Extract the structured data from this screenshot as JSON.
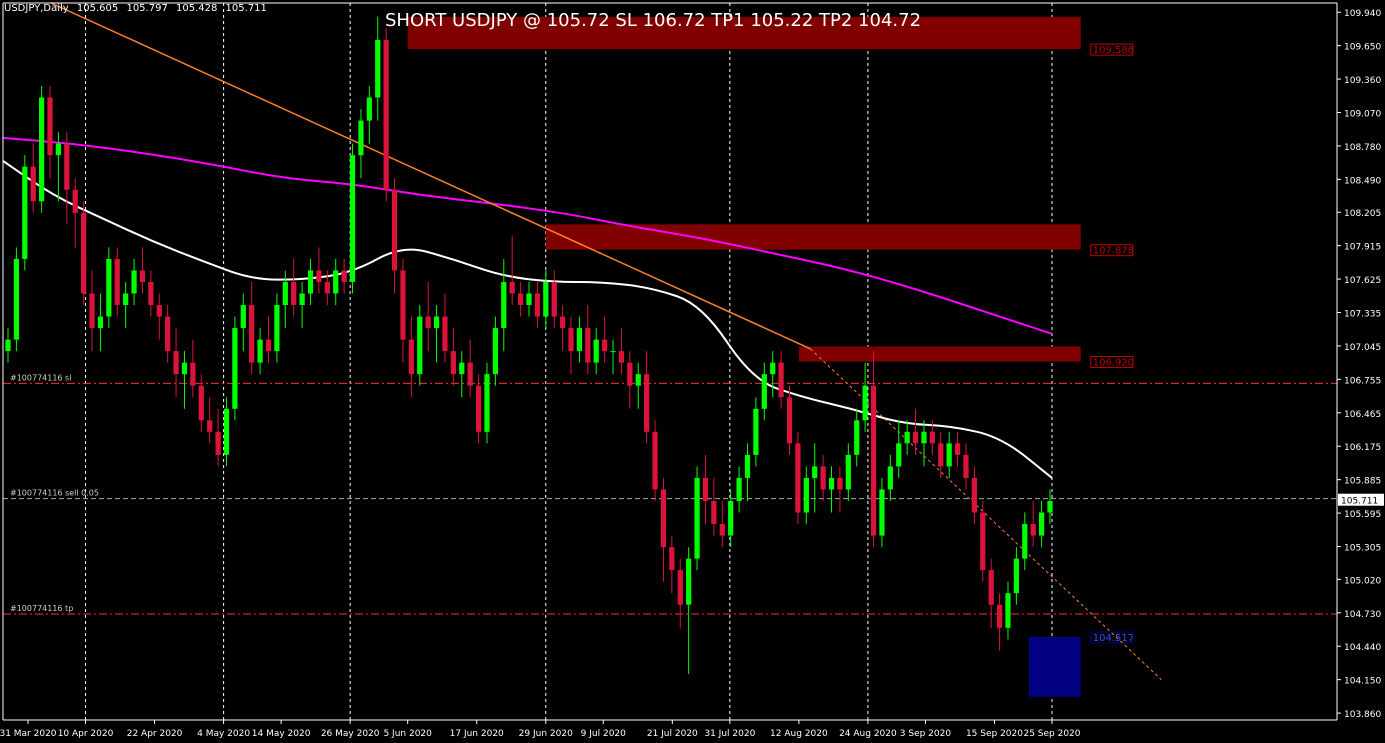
{
  "window": {
    "symbol_tf": "USDJPY,Daily",
    "ohlc": [
      "105.605",
      "105.797",
      "105.428",
      "105.711"
    ]
  },
  "title": "SHORT USDJPY @ 105.72 SL 106.72 TP1 105.22 TP2 104.72",
  "colors": {
    "background": "#000000",
    "bull": "#00ff00",
    "bear": "#dc143c",
    "ma_fast": "#ffffff",
    "ma_slow": "#ff00ff",
    "trendline": "#ff7f27",
    "zone": "#800000",
    "demand_zone": "#000080",
    "order_line": "#ff3030",
    "entry_line": "#8fbc8f"
  },
  "chart_data": {
    "type": "candlestick",
    "ylim": [
      103.8,
      110.02
    ],
    "y_ticks": [
      "109.940",
      "109.650",
      "109.360",
      "109.070",
      "108.780",
      "108.490",
      "108.205",
      "107.915",
      "107.625",
      "107.335",
      "107.045",
      "106.755",
      "106.465",
      "106.175",
      "105.885",
      "105.595",
      "105.305",
      "105.020",
      "104.730",
      "104.440",
      "104.150",
      "103.860"
    ],
    "x_ticks": [
      "31 Mar 2020",
      "10 Apr 2020",
      "22 Apr 2020",
      "4 May 2020",
      "14 May 2020",
      "26 May 2020",
      "5 Jun 2020",
      "17 Jun 2020",
      "29 Jun 2020",
      "9 Jul 2020",
      "21 Jul 2020",
      "31 Jul 2020",
      "12 Aug 2020",
      "24 Aug 2020",
      "3 Sep 2020",
      "15 Sep 2020",
      "25 Sep 2020"
    ],
    "grid_dates": [
      "10 Apr 2020",
      "4 May 2020",
      "26 May 2020",
      "29 Jun 2020",
      "31 Jul 2020",
      "24 Aug 2020",
      "25 Sep 2020"
    ],
    "current_price": "105.711",
    "zones": [
      {
        "label": "109.586",
        "high": 109.9,
        "low": 109.62,
        "start": "5 Jun 2020",
        "end": "30 Sep 2020"
      },
      {
        "label": "107.878",
        "high": 108.1,
        "low": 107.88,
        "start": "29 Jun 2020",
        "end": "30 Sep 2020"
      },
      {
        "label": "106.920",
        "high": 107.04,
        "low": 106.91,
        "start": "12 Aug 2020",
        "end": "30 Sep 2020"
      }
    ],
    "demand_zone": {
      "label": "104.517",
      "high": 104.52,
      "low": 104.0,
      "start": "21 Sep 2020",
      "end": "30 Sep 2020"
    },
    "order_lines": [
      {
        "label": "#100774116 sl",
        "price": 106.72,
        "style": "dashdot"
      },
      {
        "label": "#100774116 sell 0.05",
        "price": 105.72,
        "style": "dash"
      },
      {
        "label": "#100774116 tp",
        "price": 104.72,
        "style": "dashdot"
      }
    ],
    "trendline": {
      "start": {
        "date": "4 Apr 2020",
        "price": 110.02
      },
      "end": {
        "date": "14 Aug 2020",
        "price": 107.02
      },
      "extend_to": {
        "date": "14 Oct 2020",
        "price": 104.15
      }
    },
    "ma_fast": [
      108.65,
      108.35,
      108.15,
      107.95,
      107.78,
      107.62,
      107.62,
      107.68,
      107.92,
      107.8,
      107.65,
      107.6,
      107.6,
      107.55,
      107.4,
      106.75,
      106.6,
      106.5,
      106.37,
      106.35,
      106.25,
      105.9
    ],
    "ma_slow": [
      108.85,
      108.8,
      108.72,
      108.62,
      108.5,
      108.45,
      108.35,
      108.28,
      108.2,
      108.08,
      107.98,
      107.85,
      107.72,
      107.55,
      107.35,
      107.15
    ],
    "candles": [
      [
        107.0,
        107.2,
        106.9,
        107.1
      ],
      [
        107.1,
        107.9,
        107.0,
        107.8
      ],
      [
        107.8,
        108.7,
        107.7,
        108.6
      ],
      [
        108.6,
        108.8,
        108.2,
        108.3
      ],
      [
        108.3,
        109.3,
        108.2,
        109.2
      ],
      [
        109.2,
        109.3,
        108.5,
        108.7
      ],
      [
        108.7,
        108.9,
        108.3,
        108.8
      ],
      [
        108.8,
        108.9,
        108.1,
        108.4
      ],
      [
        108.4,
        108.5,
        107.9,
        108.2
      ],
      [
        108.2,
        108.3,
        107.4,
        107.5
      ],
      [
        107.5,
        107.7,
        107.0,
        107.2
      ],
      [
        107.2,
        107.5,
        107.0,
        107.3
      ],
      [
        107.3,
        107.9,
        107.2,
        107.8
      ],
      [
        107.8,
        107.9,
        107.3,
        107.4
      ],
      [
        107.4,
        107.6,
        107.2,
        107.5
      ],
      [
        107.5,
        107.8,
        107.4,
        107.7
      ],
      [
        107.7,
        107.9,
        107.5,
        107.6
      ],
      [
        107.6,
        107.7,
        107.3,
        107.4
      ],
      [
        107.4,
        107.5,
        107.1,
        107.3
      ],
      [
        107.3,
        107.4,
        106.9,
        107.0
      ],
      [
        107.0,
        107.2,
        106.6,
        106.8
      ],
      [
        106.8,
        107.0,
        106.5,
        106.9
      ],
      [
        106.9,
        107.1,
        106.6,
        106.7
      ],
      [
        106.7,
        106.8,
        106.3,
        106.4
      ],
      [
        106.4,
        106.6,
        106.2,
        106.3
      ],
      [
        106.3,
        106.5,
        106.0,
        106.1
      ],
      [
        106.1,
        106.6,
        106.0,
        106.5
      ],
      [
        106.5,
        107.3,
        106.4,
        107.2
      ],
      [
        107.2,
        107.5,
        107.0,
        107.4
      ],
      [
        107.4,
        107.6,
        106.8,
        106.9
      ],
      [
        106.9,
        107.2,
        106.8,
        107.1
      ],
      [
        107.1,
        107.3,
        106.9,
        107.0
      ],
      [
        107.0,
        107.5,
        106.9,
        107.4
      ],
      [
        107.4,
        107.7,
        107.2,
        107.6
      ],
      [
        107.6,
        107.8,
        107.3,
        107.4
      ],
      [
        107.4,
        107.6,
        107.2,
        107.5
      ],
      [
        107.5,
        107.8,
        107.4,
        107.7
      ],
      [
        107.7,
        107.9,
        107.5,
        107.6
      ],
      [
        107.6,
        107.7,
        107.4,
        107.5
      ],
      [
        107.5,
        107.8,
        107.4,
        107.7
      ],
      [
        107.7,
        107.8,
        107.5,
        107.6
      ],
      [
        107.6,
        108.8,
        107.5,
        108.7
      ],
      [
        108.7,
        109.1,
        108.5,
        109.0
      ],
      [
        109.0,
        109.3,
        108.8,
        109.2
      ],
      [
        109.2,
        109.9,
        109.0,
        109.7
      ],
      [
        109.7,
        109.8,
        108.3,
        108.4
      ],
      [
        108.4,
        108.5,
        107.5,
        107.7
      ],
      [
        107.7,
        107.8,
        106.9,
        107.1
      ],
      [
        107.1,
        107.3,
        106.6,
        106.8
      ],
      [
        106.8,
        107.4,
        106.7,
        107.3
      ],
      [
        107.3,
        107.6,
        107.0,
        107.2
      ],
      [
        107.2,
        107.4,
        106.9,
        107.3
      ],
      [
        107.3,
        107.5,
        106.9,
        107.0
      ],
      [
        107.0,
        107.2,
        106.7,
        106.8
      ],
      [
        106.8,
        107.0,
        106.6,
        106.9
      ],
      [
        106.9,
        107.1,
        106.6,
        106.7
      ],
      [
        106.7,
        106.8,
        106.2,
        106.3
      ],
      [
        106.3,
        106.9,
        106.2,
        106.8
      ],
      [
        106.8,
        107.3,
        106.7,
        107.2
      ],
      [
        107.2,
        107.8,
        107.0,
        107.6
      ],
      [
        107.6,
        108.0,
        107.4,
        107.5
      ],
      [
        107.5,
        107.6,
        107.3,
        107.4
      ],
      [
        107.4,
        107.6,
        107.3,
        107.5
      ],
      [
        107.5,
        107.6,
        107.2,
        107.3
      ],
      [
        107.3,
        107.7,
        107.2,
        107.6
      ],
      [
        107.6,
        107.7,
        107.2,
        107.3
      ],
      [
        107.3,
        107.4,
        107.0,
        107.2
      ],
      [
        107.2,
        107.3,
        106.8,
        107.0
      ],
      [
        107.0,
        107.3,
        106.9,
        107.2
      ],
      [
        107.2,
        107.4,
        106.8,
        106.9
      ],
      [
        106.9,
        107.2,
        106.8,
        107.1
      ],
      [
        107.1,
        107.3,
        106.9,
        107.0
      ],
      [
        107.0,
        107.1,
        106.8,
        107.0
      ],
      [
        107.0,
        107.2,
        106.8,
        106.9
      ],
      [
        106.9,
        107.0,
        106.5,
        106.7
      ],
      [
        106.7,
        106.9,
        106.5,
        106.8
      ],
      [
        106.8,
        107.0,
        106.2,
        106.3
      ],
      [
        106.3,
        106.4,
        105.7,
        105.8
      ],
      [
        105.8,
        105.9,
        105.0,
        105.3
      ],
      [
        105.3,
        105.4,
        104.9,
        105.1
      ],
      [
        105.1,
        105.2,
        104.6,
        104.8
      ],
      [
        104.8,
        105.3,
        104.2,
        105.2
      ],
      [
        105.2,
        106.0,
        105.1,
        105.9
      ],
      [
        105.9,
        106.1,
        105.5,
        105.7
      ],
      [
        105.7,
        105.9,
        105.4,
        105.5
      ],
      [
        105.5,
        105.7,
        105.3,
        105.4
      ],
      [
        105.4,
        105.8,
        105.3,
        105.7
      ],
      [
        105.7,
        106.0,
        105.6,
        105.9
      ],
      [
        105.9,
        106.2,
        105.7,
        106.1
      ],
      [
        106.1,
        106.6,
        106.0,
        106.5
      ],
      [
        106.5,
        106.9,
        106.4,
        106.8
      ],
      [
        106.8,
        107.0,
        106.6,
        106.9
      ],
      [
        106.9,
        107.0,
        106.5,
        106.6
      ],
      [
        106.6,
        106.7,
        106.1,
        106.2
      ],
      [
        106.2,
        106.3,
        105.5,
        105.6
      ],
      [
        105.6,
        106.0,
        105.5,
        105.9
      ],
      [
        105.9,
        106.2,
        105.6,
        106.0
      ],
      [
        106.0,
        106.1,
        105.7,
        105.8
      ],
      [
        105.8,
        106.0,
        105.6,
        105.9
      ],
      [
        105.9,
        106.0,
        105.6,
        105.8
      ],
      [
        105.8,
        106.2,
        105.7,
        106.1
      ],
      [
        106.1,
        106.5,
        106.0,
        106.4
      ],
      [
        106.4,
        106.9,
        106.3,
        106.7
      ],
      [
        106.7,
        107.0,
        105.3,
        105.4
      ],
      [
        105.4,
        105.9,
        105.3,
        105.8
      ],
      [
        105.8,
        106.1,
        105.7,
        106.0
      ],
      [
        106.0,
        106.4,
        105.9,
        106.2
      ],
      [
        106.2,
        106.4,
        106.1,
        106.3
      ],
      [
        106.3,
        106.5,
        106.1,
        106.2
      ],
      [
        106.2,
        106.4,
        106.0,
        106.3
      ],
      [
        106.3,
        106.4,
        106.1,
        106.2
      ],
      [
        106.2,
        106.3,
        105.9,
        106.0
      ],
      [
        106.0,
        106.3,
        105.9,
        106.2
      ],
      [
        106.2,
        106.3,
        106.0,
        106.1
      ],
      [
        106.1,
        106.2,
        105.8,
        105.9
      ],
      [
        105.9,
        106.0,
        105.5,
        105.6
      ],
      [
        105.6,
        105.7,
        105.0,
        105.1
      ],
      [
        105.1,
        105.2,
        104.6,
        104.8
      ],
      [
        104.8,
        104.9,
        104.4,
        104.6
      ],
      [
        104.6,
        105.0,
        104.5,
        104.9
      ],
      [
        104.9,
        105.3,
        104.8,
        105.2
      ],
      [
        105.2,
        105.6,
        105.1,
        105.5
      ],
      [
        105.5,
        105.7,
        105.3,
        105.4
      ],
      [
        105.4,
        105.7,
        105.3,
        105.6
      ],
      [
        105.6,
        105.8,
        105.5,
        105.7
      ]
    ]
  }
}
